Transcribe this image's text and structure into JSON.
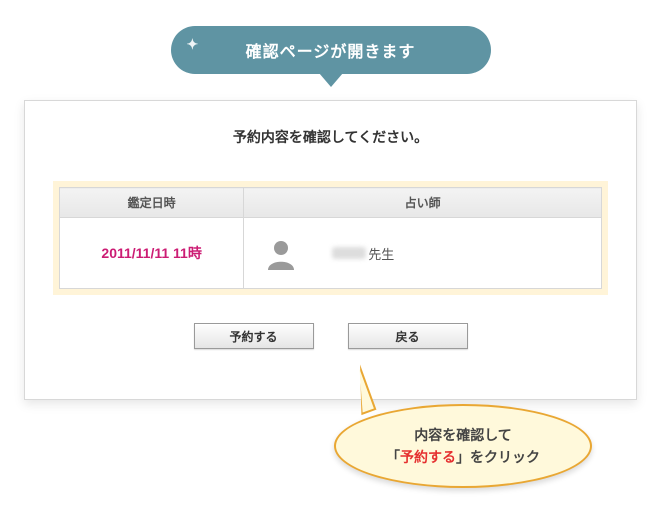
{
  "top_bubble": {
    "text": "確認ページが開きます"
  },
  "panel": {
    "title": "予約内容を確認してください。"
  },
  "table": {
    "headers": {
      "datetime": "鑑定日時",
      "teacher": "占い師"
    },
    "row": {
      "datetime": "2011/11/11 11時",
      "teacher_suffix": "先生"
    }
  },
  "buttons": {
    "reserve": "予約する",
    "back": "戻る"
  },
  "callout": {
    "line1": "内容を確認して",
    "line2_prefix": "「",
    "line2_accent": "予約する",
    "line2_suffix": "」をクリック"
  }
}
